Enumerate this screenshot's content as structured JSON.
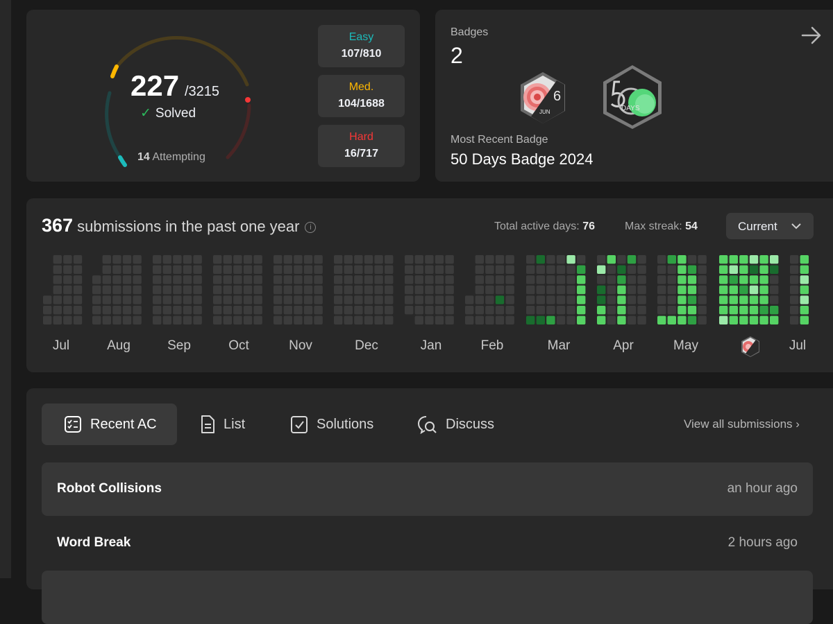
{
  "solved": {
    "count": "227",
    "total": "/3215",
    "label": "Solved",
    "attempting_count": "14",
    "attempting_label": "Attempting",
    "progress_fraction": 0.0706,
    "difficulty": [
      {
        "label": "Easy",
        "value": "107/810",
        "color": "#1cbaba"
      },
      {
        "label": "Med.",
        "value": "104/1688",
        "color": "#ffb700"
      },
      {
        "label": "Hard",
        "value": "16/717",
        "color": "#f63737"
      }
    ]
  },
  "badges": {
    "title": "Badges",
    "count": "2",
    "most_recent_label": "Most Recent Badge",
    "most_recent_name": "50 Days Badge 2024",
    "badge1_text": "6",
    "badge1_sub": "JUN",
    "badge2_text": "DAYS"
  },
  "heatmap": {
    "count": "367",
    "label": "submissions in the past one year",
    "active_days_label": "Total active days:",
    "active_days": "76",
    "max_streak_label": "Max streak:",
    "max_streak": "54",
    "selector": "Current",
    "months": [
      "Jul",
      "Aug",
      "Sep",
      "Oct",
      "Nov",
      "Dec",
      "Jan",
      "Feb",
      "Mar",
      "Apr",
      "May",
      "Jul"
    ],
    "colors": {
      "empty": "#3c3c3c",
      "l1": "#196c2e",
      "l2": "#2ea043",
      "l3": "#56d364",
      "l4": "#9be9a8"
    }
  },
  "recent": {
    "tabs": [
      {
        "label": "Recent AC",
        "icon": "checklist-icon"
      },
      {
        "label": "List",
        "icon": "document-icon"
      },
      {
        "label": "Solutions",
        "icon": "check-square-icon"
      },
      {
        "label": "Discuss",
        "icon": "discuss-icon"
      }
    ],
    "view_all": "View all submissions",
    "items": [
      {
        "title": "Robot Collisions",
        "time": "an hour ago"
      },
      {
        "title": "Word Break",
        "time": "2 hours ago"
      }
    ]
  }
}
